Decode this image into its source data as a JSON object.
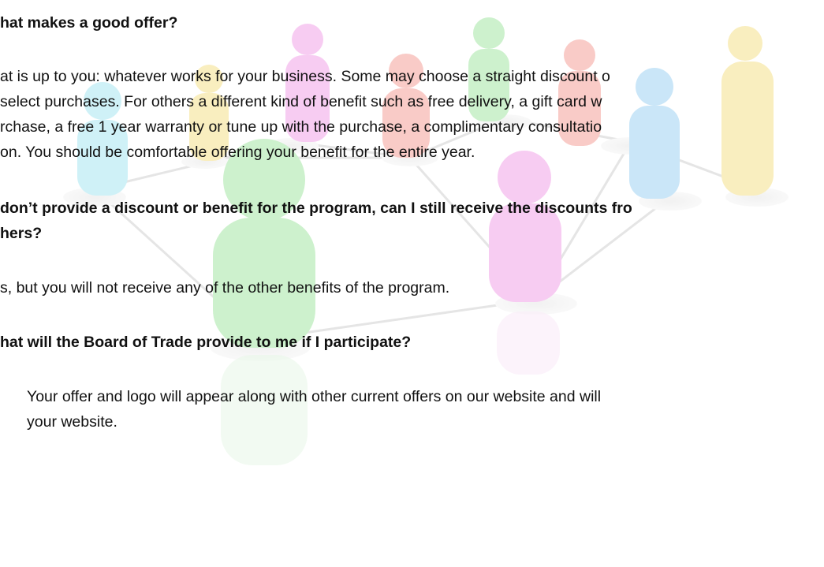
{
  "faq": {
    "q1": {
      "question": "hat makes a good offer?",
      "answer_lines": [
        "at is up to you: whatever works for your business. Some may choose a straight discount o",
        "select purchases. For others a different kind of benefit such as free delivery, a gift card w",
        "rchase, a free 1 year warranty or tune up with the purchase, a complimentary consultatio",
        "on. You should be comfortable offering your benefit for the entire year."
      ]
    },
    "q2": {
      "question_lines": [
        "don’t provide a discount or benefit for the program, can I still receive the discounts fro",
        "hers?"
      ],
      "answer": "s, but you will not receive any of the other benefits of the program."
    },
    "q3": {
      "question": "hat will the Board of Trade provide to me if I participate?",
      "answer_lines": [
        "Your offer and logo will appear along with other current offers on our website and will",
        "your website."
      ]
    }
  },
  "background": {
    "description_icon": "people-network-illustration",
    "figure_colors": [
      "#a5e5a5",
      "#f1a3e8",
      "#a8e6f0",
      "#f5a09a",
      "#f5e08a",
      "#9fd2f2",
      "#e0b0f0"
    ]
  }
}
